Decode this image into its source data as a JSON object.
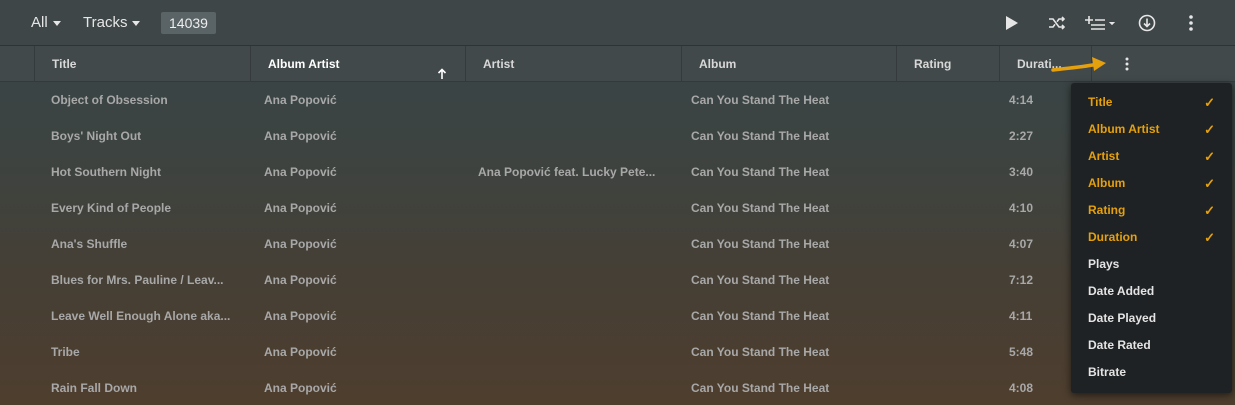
{
  "toolbar": {
    "filter_label": "All",
    "type_label": "Tracks",
    "item_count": "14039"
  },
  "columns": [
    {
      "label": "Title"
    },
    {
      "label": "Album Artist"
    },
    {
      "label": "Artist"
    },
    {
      "label": "Album"
    },
    {
      "label": "Rating"
    },
    {
      "label": "Durati..."
    }
  ],
  "rows": [
    {
      "title": "Object of Obsession",
      "album_artist": "Ana Popović",
      "artist": "",
      "album": "Can You Stand The Heat",
      "duration": "4:14"
    },
    {
      "title": "Boys' Night Out",
      "album_artist": "Ana Popović",
      "artist": "",
      "album": "Can You Stand The Heat",
      "duration": "2:27"
    },
    {
      "title": "Hot Southern Night",
      "album_artist": "Ana Popović",
      "artist": "Ana Popović feat. Lucky Pete...",
      "album": "Can You Stand The Heat",
      "duration": "3:40"
    },
    {
      "title": "Every Kind of People",
      "album_artist": "Ana Popović",
      "artist": "",
      "album": "Can You Stand The Heat",
      "duration": "4:10"
    },
    {
      "title": "Ana's Shuffle",
      "album_artist": "Ana Popović",
      "artist": "",
      "album": "Can You Stand The Heat",
      "duration": "4:07"
    },
    {
      "title": "Blues for Mrs. Pauline / Leav...",
      "album_artist": "Ana Popović",
      "artist": "",
      "album": "Can You Stand The Heat",
      "duration": "7:12"
    },
    {
      "title": "Leave Well Enough Alone aka...",
      "album_artist": "Ana Popović",
      "artist": "",
      "album": "Can You Stand The Heat",
      "duration": "4:11"
    },
    {
      "title": "Tribe",
      "album_artist": "Ana Popović",
      "artist": "",
      "album": "Can You Stand The Heat",
      "duration": "5:48"
    },
    {
      "title": "Rain Fall Down",
      "album_artist": "Ana Popović",
      "artist": "",
      "album": "Can You Stand The Heat",
      "duration": "4:08"
    }
  ],
  "column_menu": {
    "items": [
      {
        "label": "Title",
        "checked": true
      },
      {
        "label": "Album Artist",
        "checked": true
      },
      {
        "label": "Artist",
        "checked": true
      },
      {
        "label": "Album",
        "checked": true
      },
      {
        "label": "Rating",
        "checked": true
      },
      {
        "label": "Duration",
        "checked": true
      },
      {
        "label": "Plays",
        "checked": false
      },
      {
        "label": "Date Added",
        "checked": false
      },
      {
        "label": "Date Played",
        "checked": false
      },
      {
        "label": "Date Rated",
        "checked": false
      },
      {
        "label": "Bitrate",
        "checked": false
      }
    ],
    "check_glyph": "✓"
  },
  "colors": {
    "accent": "#e5a00d",
    "menu_bg": "#1f2224",
    "cell_text": "#a8a8a8"
  },
  "icons": [
    "caret-down-icon",
    "play-icon",
    "shuffle-icon",
    "add-to-queue-icon",
    "download-icon",
    "more-vertical-icon",
    "sort-ascending-icon",
    "check-icon",
    "annotation-arrow"
  ]
}
